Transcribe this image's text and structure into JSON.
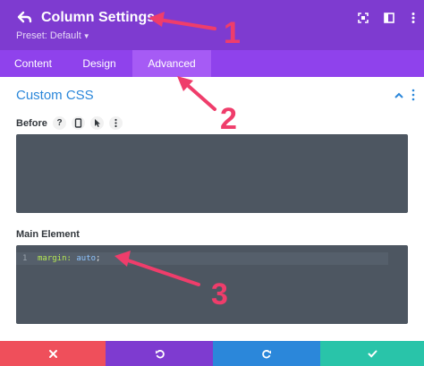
{
  "header": {
    "title": "Column Settings",
    "preset": "Preset: Default",
    "back_icon": "back-arrow-icon",
    "icons": [
      "expand-icon",
      "columns-layout-icon",
      "more-vertical-icon"
    ],
    "bg_color": "#7e3bd0"
  },
  "tabs": [
    {
      "label": "Content",
      "active": false
    },
    {
      "label": "Design",
      "active": false
    },
    {
      "label": "Advanced",
      "active": true
    }
  ],
  "section": {
    "title": "Custom CSS",
    "title_color": "#2b87da"
  },
  "fields": {
    "before": {
      "label": "Before",
      "help_icon": "?",
      "icons": [
        "help-icon",
        "mobile-icon",
        "pointer-icon",
        "more-vertical-icon"
      ]
    },
    "main_element": {
      "label": "Main Element",
      "line_number": "1",
      "code_property": "margin:",
      "code_value": "auto",
      "code_punctuation": ";"
    }
  },
  "footer": {
    "buttons": [
      {
        "name": "cancel",
        "color": "#ef4f5b"
      },
      {
        "name": "undo",
        "color": "#7e3bd0"
      },
      {
        "name": "redo",
        "color": "#2b87da"
      },
      {
        "name": "save",
        "color": "#29c4a9"
      }
    ]
  },
  "annotations": {
    "one": "1",
    "two": "2",
    "three": "3",
    "color": "#ef3d6b"
  }
}
